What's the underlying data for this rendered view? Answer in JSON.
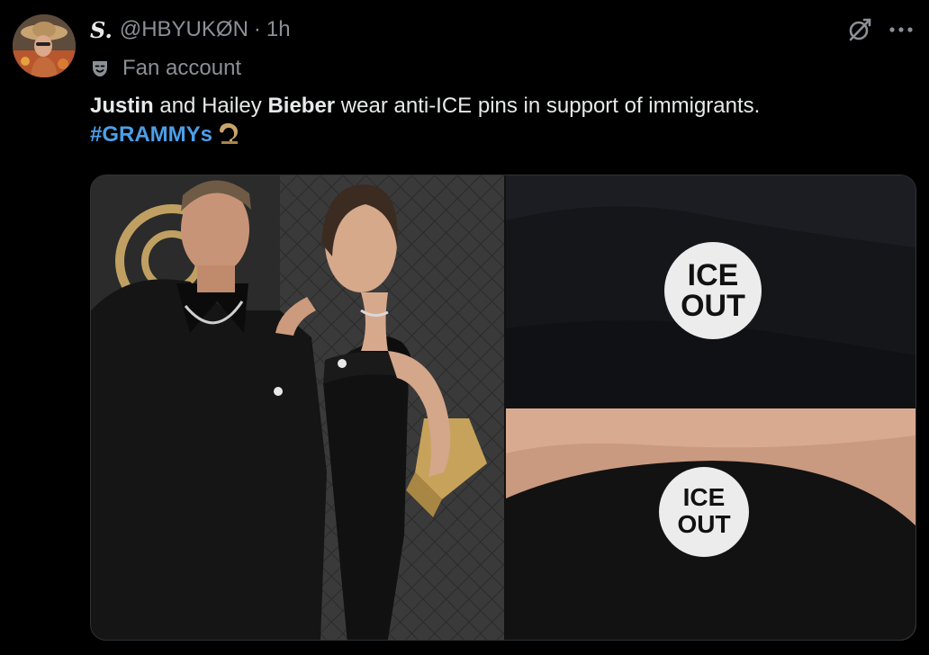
{
  "author": {
    "display_name": "S.",
    "handle": "@HBYUKØN",
    "separator": "·",
    "time": "1h",
    "label": "Fan account"
  },
  "icons": {
    "label_icon": "theater-masks-icon",
    "grok_icon": "grok-icon",
    "more_icon": "more-icon",
    "hashtag_emoji": "trophy-icon"
  },
  "tweet": {
    "word_justin": "Justin",
    "text_and_hailey": " and Hailey ",
    "word_bieber": "Bieber",
    "text_rest": " wear anti-ICE pins in support of immigrants.",
    "hashtag": "#GRAMMYs"
  },
  "media": {
    "pin_line1": "ICE",
    "pin_line2": "OUT"
  },
  "colors": {
    "background": "#000000",
    "text_primary": "#e7e9ea",
    "text_secondary": "#8b9096",
    "link": "#4c9ee8"
  }
}
